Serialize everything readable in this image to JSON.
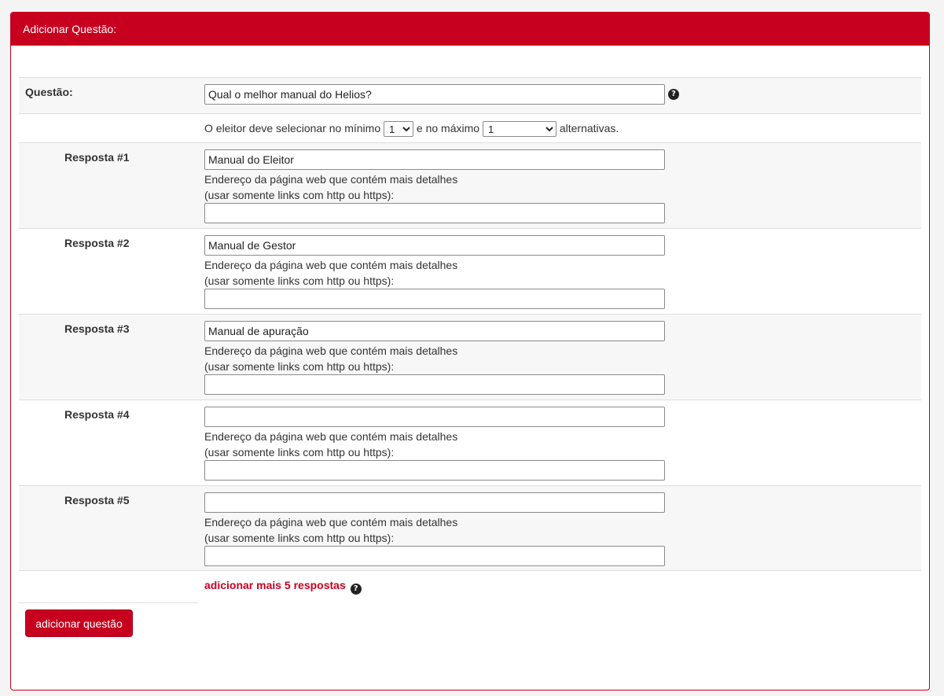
{
  "panel": {
    "title": "Adicionar Questão:"
  },
  "question": {
    "label": "Questão:",
    "value": "Qual o melhor manual do Helios?",
    "help_icon": "question-circle-icon"
  },
  "selection": {
    "prefix": "O eleitor deve selecionar no mínimo",
    "min_value": "1",
    "middle": "e no máximo",
    "max_value": "1",
    "suffix": "alternativas."
  },
  "answers": [
    {
      "label": "Resposta #1",
      "value": "Manual do Eleitor",
      "url_label_line1": "Endereço da página web que contém mais detalhes",
      "url_label_line2": "(usar somente links com http ou https):",
      "url_value": ""
    },
    {
      "label": "Resposta #2",
      "value": "Manual de Gestor",
      "url_label_line1": "Endereço da página web que contém mais detalhes",
      "url_label_line2": "(usar somente links com http ou https):",
      "url_value": ""
    },
    {
      "label": "Resposta #3",
      "value": "Manual de apuração",
      "url_label_line1": "Endereço da página web que contém mais detalhes",
      "url_label_line2": "(usar somente links com http ou https):",
      "url_value": ""
    },
    {
      "label": "Resposta #4",
      "value": "",
      "url_label_line1": "Endereço da página web que contém mais detalhes",
      "url_label_line2": "(usar somente links com http ou https):",
      "url_value": ""
    },
    {
      "label": "Resposta #5",
      "value": "",
      "url_label_line1": "Endereço da página web que contém mais detalhes",
      "url_label_line2": "(usar somente links com http ou https):",
      "url_value": ""
    }
  ],
  "add_more": {
    "label": "adicionar mais 5 respostas",
    "help_icon": "question-circle-icon"
  },
  "submit": {
    "label": "adicionar questão"
  },
  "colors": {
    "accent": "#c8001f",
    "row_shade": "#f7f7f7",
    "border": "#dddddd"
  }
}
